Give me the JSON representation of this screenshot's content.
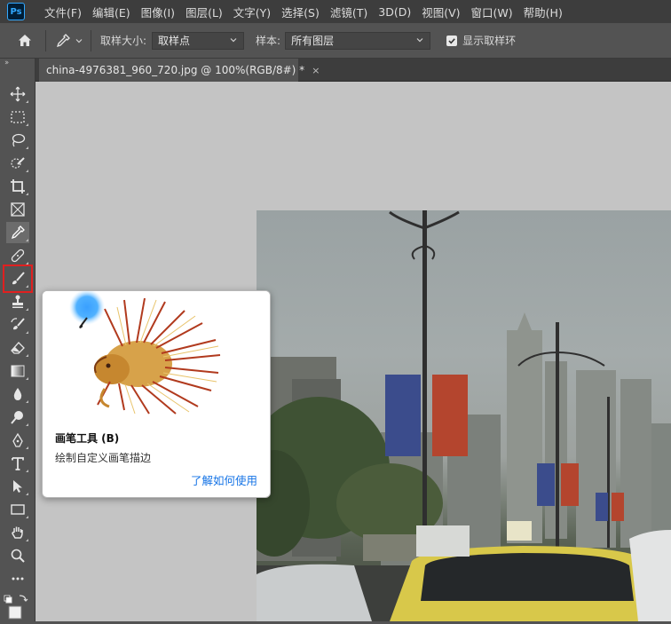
{
  "app": {
    "logo_text": "Ps"
  },
  "menu": [
    {
      "label": "文件(F)"
    },
    {
      "label": "编辑(E)"
    },
    {
      "label": "图像(I)"
    },
    {
      "label": "图层(L)"
    },
    {
      "label": "文字(Y)"
    },
    {
      "label": "选择(S)"
    },
    {
      "label": "滤镜(T)"
    },
    {
      "label": "3D(D)"
    },
    {
      "label": "视图(V)"
    },
    {
      "label": "窗口(W)"
    },
    {
      "label": "帮助(H)"
    }
  ],
  "options": {
    "sample_size_label": "取样大小:",
    "sample_size_value": "取样点",
    "sample_label": "样本:",
    "sample_value": "所有图层",
    "show_ring_label": "显示取样环",
    "show_ring_checked": true
  },
  "document_tab": {
    "title": "china-4976381_960_720.jpg @ 100%(RGB/8#) *",
    "close_glyph": "×"
  },
  "toolbar": {
    "collapse_glyph": "››",
    "tools": [
      {
        "name": "move-tool",
        "icon": "move-icon"
      },
      {
        "name": "marquee-tool",
        "icon": "rect-marquee-icon"
      },
      {
        "name": "lasso-tool",
        "icon": "lasso-icon"
      },
      {
        "name": "quick-select-tool",
        "icon": "quick-select-icon"
      },
      {
        "name": "crop-tool",
        "icon": "crop-icon"
      },
      {
        "name": "frame-tool",
        "icon": "frame-icon"
      },
      {
        "name": "eyedropper-tool",
        "icon": "eyedropper-icon",
        "active": true
      },
      {
        "name": "healing-brush-tool",
        "icon": "bandage-icon"
      },
      {
        "name": "brush-tool",
        "icon": "brush-icon",
        "highlighted": true
      },
      {
        "name": "clone-stamp-tool",
        "icon": "stamp-icon"
      },
      {
        "name": "history-brush-tool",
        "icon": "history-brush-icon"
      },
      {
        "name": "eraser-tool",
        "icon": "eraser-icon"
      },
      {
        "name": "gradient-tool",
        "icon": "gradient-icon"
      },
      {
        "name": "blur-tool",
        "icon": "drop-icon"
      },
      {
        "name": "dodge-tool",
        "icon": "dodge-icon"
      },
      {
        "name": "pen-tool",
        "icon": "pen-icon"
      },
      {
        "name": "type-tool",
        "icon": "type-icon"
      },
      {
        "name": "path-select-tool",
        "icon": "arrow-icon"
      },
      {
        "name": "rectangle-tool",
        "icon": "rectangle-icon"
      },
      {
        "name": "hand-tool",
        "icon": "hand-icon"
      },
      {
        "name": "zoom-tool",
        "icon": "zoom-icon"
      },
      {
        "name": "more-tools",
        "icon": "ellipsis-icon"
      }
    ]
  },
  "tooltip": {
    "title": "画笔工具 (B)",
    "description": "绘制自定义画笔描边",
    "link": "了解如何使用"
  },
  "colors": {
    "menubar_bg": "#3d3d3d",
    "panel_bg": "#535353",
    "canvas_bg": "#c4c4c4",
    "highlight": "#e02020",
    "link": "#1473e6"
  }
}
